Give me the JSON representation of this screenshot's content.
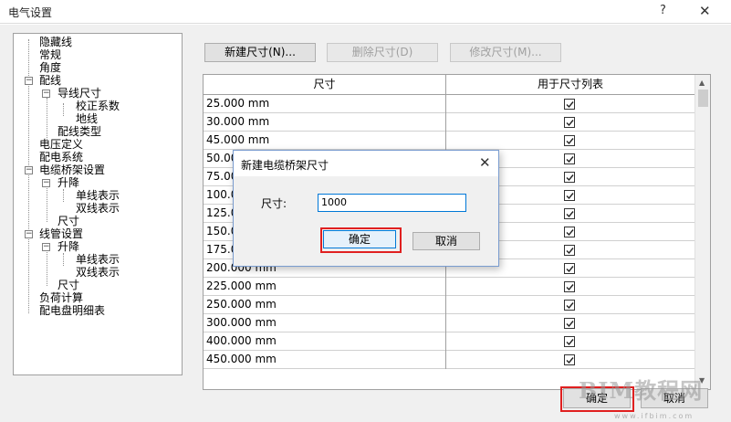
{
  "window": {
    "title": "电气设置",
    "help": "?",
    "close": "✕"
  },
  "tree": {
    "items": [
      {
        "label": "隐藏线"
      },
      {
        "label": "常规"
      },
      {
        "label": "角度"
      },
      {
        "label": "配线"
      },
      {
        "label": "导线尺寸"
      },
      {
        "label": "校正系数"
      },
      {
        "label": "地线"
      },
      {
        "label": "配线类型"
      },
      {
        "label": "电压定义"
      },
      {
        "label": "配电系统"
      },
      {
        "label": "电缆桥架设置"
      },
      {
        "label": "升降"
      },
      {
        "label": "单线表示"
      },
      {
        "label": "双线表示"
      },
      {
        "label": "尺寸"
      },
      {
        "label": "线管设置"
      },
      {
        "label": "升降"
      },
      {
        "label": "单线表示"
      },
      {
        "label": "双线表示"
      },
      {
        "label": "尺寸"
      },
      {
        "label": "负荷计算"
      },
      {
        "label": "配电盘明细表"
      }
    ]
  },
  "toolbar": {
    "new_label": "新建尺寸(N)...",
    "delete_label": "删除尺寸(D)",
    "edit_label": "修改尺寸(M)..."
  },
  "table": {
    "headers": [
      "尺寸",
      "用于尺寸列表"
    ],
    "rows": [
      {
        "size": "25.000 mm",
        "checked": true
      },
      {
        "size": "30.000 mm",
        "checked": true
      },
      {
        "size": "45.000 mm",
        "checked": true
      },
      {
        "size": "50.000 mm",
        "checked": true
      },
      {
        "size": "75.000 mm",
        "checked": true
      },
      {
        "size": "100.000 mm",
        "checked": true
      },
      {
        "size": "125.000 mm",
        "checked": true
      },
      {
        "size": "150.000 mm",
        "checked": true
      },
      {
        "size": "175.000 mm",
        "checked": true
      },
      {
        "size": "200.000 mm",
        "checked": true
      },
      {
        "size": "225.000 mm",
        "checked": true
      },
      {
        "size": "250.000 mm",
        "checked": true
      },
      {
        "size": "300.000 mm",
        "checked": true
      },
      {
        "size": "400.000 mm",
        "checked": true
      },
      {
        "size": "450.000 mm",
        "checked": true
      }
    ]
  },
  "footer": {
    "ok_label": "确定",
    "cancel_label": "取消"
  },
  "dialog": {
    "title": "新建电缆桥架尺寸",
    "close": "✕",
    "size_label": "尺寸:",
    "size_value": "1000",
    "ok_label": "确定",
    "cancel_label": "取消"
  },
  "watermark": {
    "text": "BIM教程网",
    "url": "www.ifbim.com"
  },
  "colors": {
    "highlight": "#e02020",
    "focus_border": "#0078d7"
  }
}
